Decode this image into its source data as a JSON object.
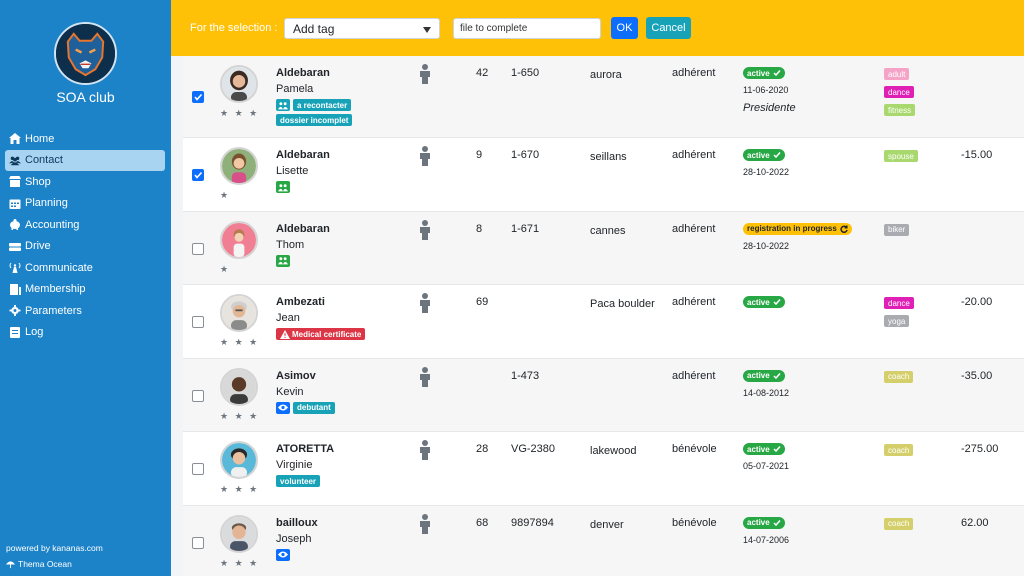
{
  "app": {
    "club_name": "SOA club",
    "powered_by": "powered by kananas.com",
    "theme": "Thema Ocean"
  },
  "nav": [
    {
      "label": "Home",
      "icon": "home-icon"
    },
    {
      "label": "Contact",
      "icon": "users-icon",
      "active": true
    },
    {
      "label": "Shop",
      "icon": "shop-icon"
    },
    {
      "label": "Planning",
      "icon": "calendar-icon"
    },
    {
      "label": "Accounting",
      "icon": "piggy-bank-icon"
    },
    {
      "label": "Drive",
      "icon": "drive-icon"
    },
    {
      "label": "Communicate",
      "icon": "broadcast-icon"
    },
    {
      "label": "Membership",
      "icon": "membership-icon"
    },
    {
      "label": "Parameters",
      "icon": "gear-icon"
    },
    {
      "label": "Log",
      "icon": "log-icon"
    }
  ],
  "toolbar": {
    "selection_label": "For the selection :",
    "action_select_value": "Add tag",
    "text_input_value": "file to complete",
    "ok_label": "OK",
    "cancel_label": "Cancel"
  },
  "colors": {
    "sidebar": "#1d83c8",
    "topbar": "#ffc107",
    "status_active": "#28a745",
    "status_pending": "#ffc107",
    "badge_info": "#17a2b8",
    "badge_danger": "#dc3545",
    "badge_primary": "#0d6efd"
  },
  "rows": [
    {
      "checked": true,
      "stars": "★ ★ ★",
      "lastname": "Aldebaran",
      "firstname": "Pamela",
      "badges": [
        {
          "icon": "group",
          "label": "a recontacter"
        },
        {
          "label": "dossier incomplet"
        }
      ],
      "age": "42",
      "number": "1-650",
      "city": "aurora",
      "type": "adhérent",
      "status": "active",
      "status_style": "active",
      "date": "11-06-2020",
      "role": "Presidente",
      "tags": [
        {
          "label": "adult",
          "color": "#f5a3c7"
        },
        {
          "label": "dance",
          "color": "#e020b5"
        },
        {
          "label": "fitness",
          "color": "#a8d86e"
        }
      ],
      "amount": ""
    },
    {
      "checked": true,
      "stars": "★",
      "lastname": "Aldebaran",
      "firstname": "Lisette",
      "badges": [
        {
          "icon": "group"
        }
      ],
      "age": "9",
      "number": "1-670",
      "city": "seillans",
      "type": "adhérent",
      "status": "active",
      "status_style": "active",
      "date": "28-10-2022",
      "role": "",
      "tags": [
        {
          "label": "spouse",
          "color": "#a8d86e"
        }
      ],
      "amount": "-15.00"
    },
    {
      "checked": false,
      "stars": "★",
      "lastname": "Aldebaran",
      "firstname": "Thom",
      "badges": [
        {
          "icon": "group"
        }
      ],
      "age": "8",
      "number": "1-671",
      "city": "cannes",
      "type": "adhérent",
      "status": "registration in progress",
      "status_style": "pending",
      "date": "28-10-2022",
      "role": "",
      "tags": [
        {
          "label": "biker",
          "color": "#a9abb0"
        }
      ],
      "amount": ""
    },
    {
      "checked": false,
      "stars": "★ ★ ★",
      "lastname": "Ambezati",
      "firstname": "Jean",
      "badges": [
        {
          "icon": "warning",
          "label": "Medical certificate",
          "style": "red"
        }
      ],
      "age": "69",
      "number": "",
      "city": "Paca boulder",
      "type": "adhérent",
      "status": "active",
      "status_style": "active",
      "date": "",
      "role": "",
      "tags": [
        {
          "label": "dance",
          "color": "#e020b5"
        },
        {
          "label": "yoga",
          "color": "#a9abb0"
        }
      ],
      "amount": "-20.00"
    },
    {
      "checked": false,
      "stars": "★ ★ ★",
      "lastname": "Asimov",
      "firstname": "Kevin",
      "badges": [
        {
          "icon": "eye",
          "style": "blue"
        },
        {
          "label": "debutant"
        }
      ],
      "age": "",
      "number": "1-473",
      "city": "",
      "type": "adhérent",
      "status": "active",
      "status_style": "active",
      "date": "14-08-2012",
      "role": "",
      "tags": [
        {
          "label": "coach",
          "color": "#d4cf6a"
        }
      ],
      "amount": "-35.00"
    },
    {
      "checked": false,
      "stars": "★ ★ ★",
      "lastname": "ATORETTA",
      "firstname": "Virginie",
      "badges": [
        {
          "label": "volunteer"
        }
      ],
      "age": "28",
      "number": "VG-2380",
      "city": "lakewood",
      "type": "bénévole",
      "status": "active",
      "status_style": "active",
      "date": "05-07-2021",
      "role": "",
      "tags": [
        {
          "label": "coach",
          "color": "#d4cf6a"
        }
      ],
      "amount": "-275.00"
    },
    {
      "checked": false,
      "stars": "★ ★ ★",
      "lastname": "bailloux",
      "firstname": "Joseph",
      "badges": [
        {
          "icon": "eye",
          "style": "blue"
        }
      ],
      "age": "68",
      "number": "9897894",
      "city": "denver",
      "type": "bénévole",
      "status": "active",
      "status_style": "active",
      "date": "14-07-2006",
      "role": "",
      "tags": [
        {
          "label": "coach",
          "color": "#d4cf6a"
        }
      ],
      "amount": "62.00"
    }
  ]
}
